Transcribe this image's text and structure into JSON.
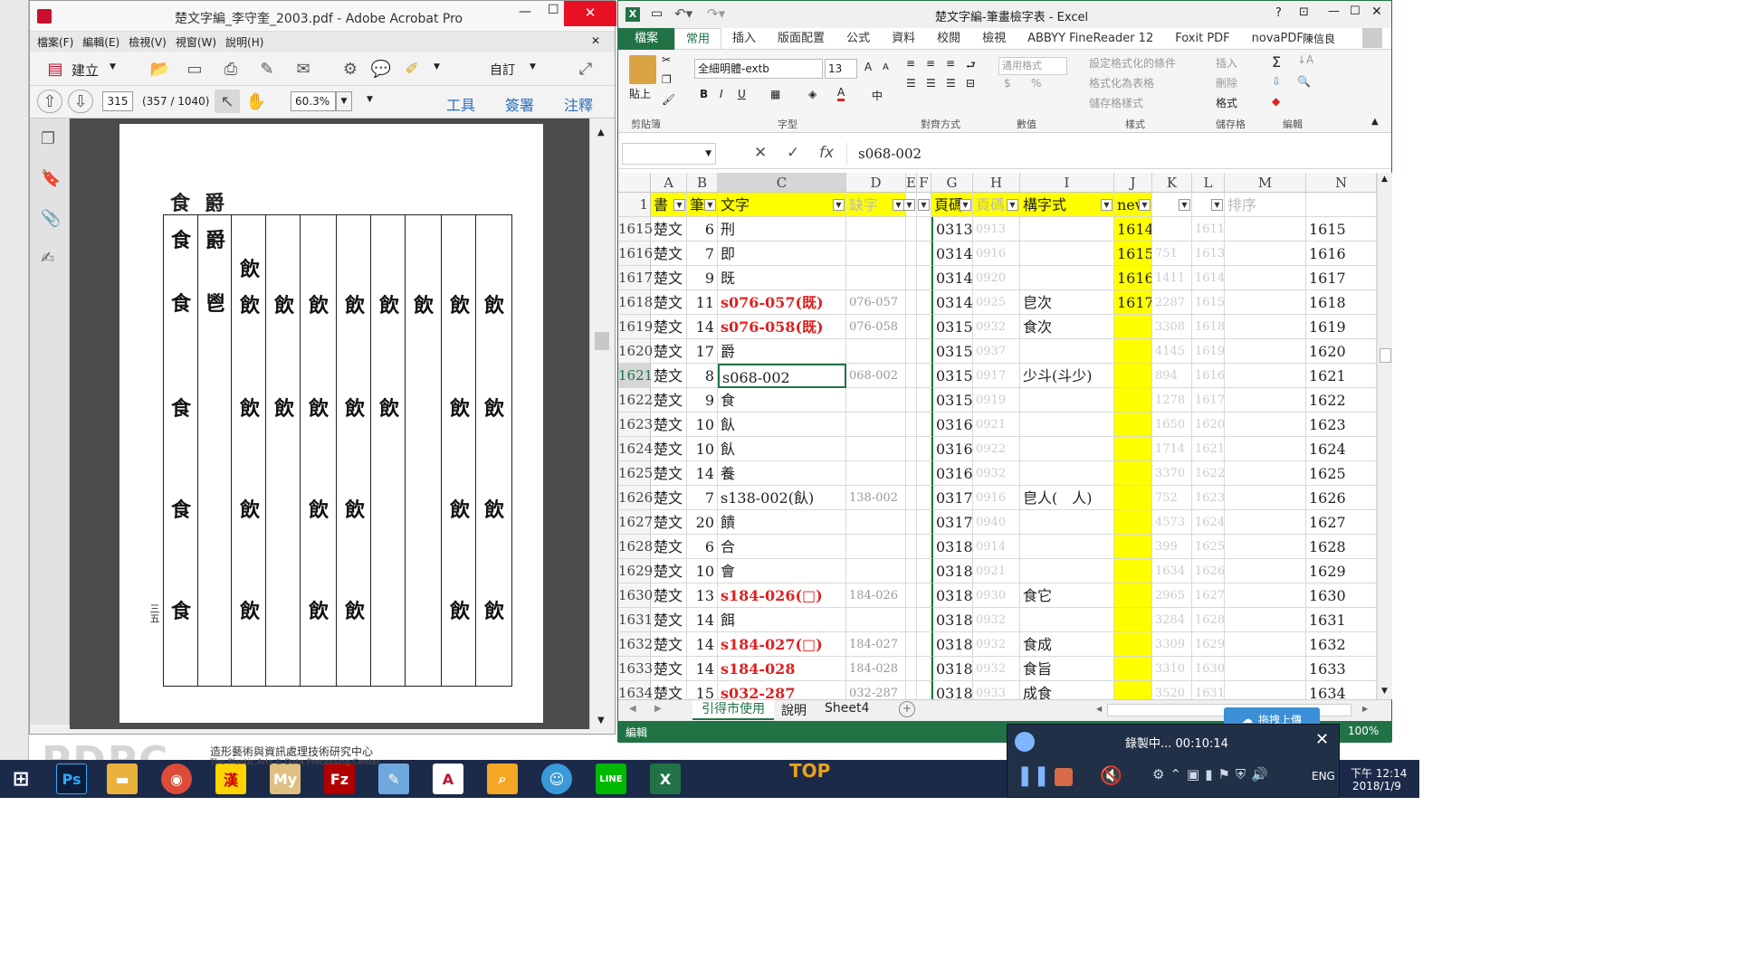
{
  "acrobat": {
    "title": "楚文字編_李守奎_2003.pdf - Adobe Acrobat Pro",
    "menu": [
      "檔案(F)",
      "編輯(E)",
      "檢視(V)",
      "視窗(W)",
      "說明(H)"
    ],
    "create_label": "建立",
    "customize_label": "自訂",
    "page_current": "315",
    "page_info": "(357 / 1040)",
    "zoom": "60.3%",
    "panels": [
      "工具",
      "簽署",
      "注釋"
    ],
    "page_headings": [
      "食",
      "爵"
    ],
    "page_number_vertical": "三五",
    "glyph_rows": [
      [
        "食",
        "爵",
        "飲",
        "",
        "",
        "",
        "",
        "",
        "",
        "",
        ""
      ],
      [
        "食",
        "鬯",
        "飲",
        "飲",
        "飲",
        "飲",
        "飲",
        "飲",
        "飲",
        "飲",
        "飲"
      ]
    ]
  },
  "excel": {
    "title": "楚文字編-筆畫檢字表 - Excel",
    "user": "陳信良",
    "file_tab": "檔案",
    "ribbon_tabs": [
      "常用",
      "插入",
      "版面配置",
      "公式",
      "資料",
      "校閱",
      "檢視",
      "ABBYY FineReader 12",
      "Foxit PDF",
      "novaPDF"
    ],
    "font_name": "全細明體-extb",
    "font_size": "13",
    "ribbon": {
      "paste": "貼上",
      "clipboard": "剪貼簿",
      "font_group": "字型",
      "align_group": "對齊方式",
      "number_group": "數值",
      "style_group": "樣式",
      "cells_group": "儲存格",
      "edit_group": "編輯",
      "number_format": "通用格式",
      "cond_format": "設定格式化的條件",
      "as_table": "格式化為表格",
      "cell_styles": "儲存格樣式",
      "insert": "插入",
      "delete": "刪除",
      "format": "格式"
    },
    "formula_value": "s068-002",
    "col_letters": [
      "A",
      "B",
      "C",
      "D",
      "E",
      "F",
      "G",
      "H",
      "I",
      "J",
      "K",
      "L",
      "M",
      "N"
    ],
    "header_row": {
      "A": "書",
      "B": "筆",
      "C": "文字",
      "D": "缺字",
      "G": "頁碼",
      "H": "頁碼",
      "I": "構字式",
      "J": "nev",
      "M": "排序"
    },
    "rows": [
      {
        "n": "1615",
        "a": "楚文",
        "b": "6",
        "c": "刑",
        "d": "",
        "g": "0313",
        "h": "0913",
        "i": "",
        "j": "1614",
        "k": "",
        "l": "1611",
        "red": false
      },
      {
        "n": "1616",
        "a": "楚文",
        "b": "7",
        "c": "即",
        "d": "",
        "g": "0314",
        "h": "0916",
        "i": "",
        "j": "1615",
        "k": "751",
        "l": "1613",
        "red": false
      },
      {
        "n": "1617",
        "a": "楚文",
        "b": "9",
        "c": "既",
        "d": "",
        "g": "0314",
        "h": "0920",
        "i": "",
        "j": "1616",
        "k": "1411",
        "l": "1614",
        "red": false
      },
      {
        "n": "1618",
        "a": "楚文",
        "b": "11",
        "c": "s076-057(既)",
        "d": "076-057",
        "g": "0314",
        "h": "0925",
        "i": "皀次",
        "j": "1617",
        "k": "2287",
        "l": "1615",
        "red": true
      },
      {
        "n": "1619",
        "a": "楚文",
        "b": "14",
        "c": "s076-058(既)",
        "d": "076-058",
        "g": "0315",
        "h": "0932",
        "i": "食次",
        "j": "",
        "k": "3308",
        "l": "1618",
        "red": true
      },
      {
        "n": "1620",
        "a": "楚文",
        "b": "17",
        "c": "爵",
        "d": "",
        "g": "0315",
        "h": "0937",
        "i": "",
        "j": "",
        "k": "4145",
        "l": "1619",
        "red": false
      },
      {
        "n": "1621",
        "a": "楚文",
        "b": "8",
        "c": "s068-002",
        "d": "068-002",
        "g": "0315",
        "h": "0917",
        "i": "少斗(斗少)",
        "j": "",
        "k": "894",
        "l": "1616",
        "red": false,
        "selected": true
      },
      {
        "n": "1622",
        "a": "楚文",
        "b": "9",
        "c": "食",
        "d": "",
        "g": "0315",
        "h": "0919",
        "i": "",
        "j": "",
        "k": "1278",
        "l": "1617",
        "red": false
      },
      {
        "n": "1623",
        "a": "楚文",
        "b": "10",
        "c": "飤",
        "d": "",
        "g": "0316",
        "h": "0921",
        "i": "",
        "j": "",
        "k": "1650",
        "l": "1620",
        "red": false
      },
      {
        "n": "1624",
        "a": "楚文",
        "b": "10",
        "c": "飤",
        "d": "",
        "g": "0316",
        "h": "0922",
        "i": "",
        "j": "",
        "k": "1714",
        "l": "1621",
        "red": false
      },
      {
        "n": "1625",
        "a": "楚文",
        "b": "14",
        "c": "養",
        "d": "",
        "g": "0316",
        "h": "0932",
        "i": "",
        "j": "",
        "k": "3370",
        "l": "1622",
        "red": false
      },
      {
        "n": "1626",
        "a": "楚文",
        "b": "7",
        "c": "s138-002(飤)",
        "d": "138-002",
        "g": "0317",
        "h": "0916",
        "i": "皀人(　人)",
        "j": "",
        "k": "752",
        "l": "1623",
        "red": false
      },
      {
        "n": "1627",
        "a": "楚文",
        "b": "20",
        "c": "饋",
        "d": "",
        "g": "0317",
        "h": "0940",
        "i": "",
        "j": "",
        "k": "4573",
        "l": "1624",
        "red": false
      },
      {
        "n": "1628",
        "a": "楚文",
        "b": "6",
        "c": "合",
        "d": "",
        "g": "0318",
        "h": "0914",
        "i": "",
        "j": "",
        "k": "399",
        "l": "1625",
        "red": false
      },
      {
        "n": "1629",
        "a": "楚文",
        "b": "10",
        "c": "會",
        "d": "",
        "g": "0318",
        "h": "0921",
        "i": "",
        "j": "",
        "k": "1634",
        "l": "1626",
        "red": false
      },
      {
        "n": "1630",
        "a": "楚文",
        "b": "13",
        "c": "s184-026(□)",
        "d": "184-026",
        "g": "0318",
        "h": "0930",
        "i": "食它",
        "j": "",
        "k": "2965",
        "l": "1627",
        "red": true
      },
      {
        "n": "1631",
        "a": "楚文",
        "b": "14",
        "c": "餌",
        "d": "",
        "g": "0318",
        "h": "0932",
        "i": "",
        "j": "",
        "k": "3284",
        "l": "1628",
        "red": false
      },
      {
        "n": "1632",
        "a": "楚文",
        "b": "14",
        "c": "s184-027(□)",
        "d": "184-027",
        "g": "0318",
        "h": "0932",
        "i": "食成",
        "j": "",
        "k": "3309",
        "l": "1629",
        "red": true
      },
      {
        "n": "1633",
        "a": "楚文",
        "b": "14",
        "c": "s184-028",
        "d": "184-028",
        "g": "0318",
        "h": "0932",
        "i": "食旨",
        "j": "",
        "k": "3310",
        "l": "1630",
        "red": true
      },
      {
        "n": "1634",
        "a": "楚文",
        "b": "15",
        "c": "s032-287",
        "d": "032-287",
        "g": "0318",
        "h": "0933",
        "i": "成食",
        "j": "",
        "k": "3520",
        "l": "1631",
        "red": true
      }
    ],
    "sheet_tabs": [
      "引得市使用",
      "說明",
      "Sheet4"
    ],
    "status_mode": "編輯",
    "zoom": "100%"
  },
  "recorder": {
    "status": "錄製中... 00:10:14",
    "upload_label": "拖拽上傳"
  },
  "taskbar": {
    "time": "下午 12:14",
    "date": "2018/1/9",
    "lang": "ENG"
  },
  "desktop": {
    "lab_name": "造形藝術與資訊處理技術研究中心",
    "lab_abbr": "PDPC",
    "lab_en": "The Plastic Arts & Data Processing Center",
    "badge": "TOP"
  }
}
